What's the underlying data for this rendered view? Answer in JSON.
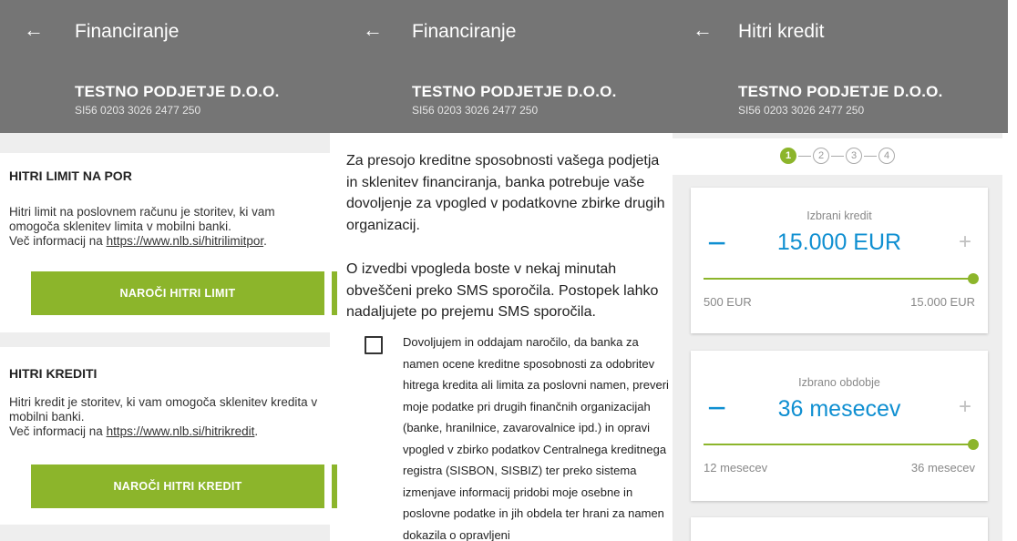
{
  "panel1": {
    "back_icon": "←",
    "title": "Financiranje",
    "company": "TESTNO PODJETJE D.O.O.",
    "iban": "SI56 0203 3026 2477 250",
    "limit": {
      "heading": "HITRI LIMIT NA POR",
      "text": "Hitri limit na poslovnem računu je storitev, ki vam omogoča sklenitev limita v mobilni banki.",
      "more_prefix": "Več informacij na ",
      "link": "https://www.nlb.si/hitrilimitpor",
      "suffix": ".",
      "button": "NAROČI HITRI LIMIT"
    },
    "credit": {
      "heading": "HITRI KREDITI",
      "text": "Hitri kredit je storitev, ki vam omogoča sklenitev kredita v mobilni banki.",
      "more_prefix": "Več informacij na ",
      "link": "https://www.nlb.si/hitrikredit",
      "suffix": ".",
      "button": "NAROČI HITRI KREDIT"
    }
  },
  "panel2": {
    "back_icon": "←",
    "title": "Financiranje",
    "company": "TESTNO PODJETJE D.O.O.",
    "iban": "SI56 0203 3026 2477 250",
    "para1": "Za presojo kreditne sposobnosti vašega podjetja in sklenitev financiranja, banka potrebuje vaše dovoljenje za vpogled v podatkovne zbirke drugih organizacij.",
    "para2": "O izvedbi vpogleda boste v nekaj minutah obveščeni preko SMS sporočila. Postopek lahko nadaljujete po prejemu SMS sporočila.",
    "consent": "Dovoljujem in oddajam naročilo, da banka za namen ocene kreditne sposobnosti za odobritev hitrega kredita ali limita za poslovni namen, preveri moje podatke pri drugih finančnih organizacijah (banke, hranilnice, zavarovalnice ipd.) in opravi vpogled v zbirko podatkov Centralnega kreditnega registra (SISBON, SISBIZ) ter preko sistema izmenjave informacij pridobi moje osebne in poslovne podatke in jih obdela ter hrani za namen dokazila o opravljeni"
  },
  "panel3": {
    "back_icon": "←",
    "title": "Hitri kredit",
    "company": "TESTNO PODJETJE D.O.O.",
    "iban": "SI56 0203 3026 2477 250",
    "steps": [
      "1",
      "2",
      "3",
      "4"
    ],
    "active_step": 1,
    "amount": {
      "label": "Izbrani kredit",
      "value": "15.000 EUR",
      "min": "500 EUR",
      "max": "15.000 EUR",
      "minus": "−",
      "plus": "+",
      "position_fraction": 1.0
    },
    "period": {
      "label": "Izbrano obdobje",
      "value": "36 mesecev",
      "min": "12 mesecev",
      "max": "36 mesecev",
      "minus": "−",
      "plus": "+",
      "position_fraction": 1.0
    }
  },
  "colors": {
    "header": "#757575",
    "accent_green": "#8cb52b",
    "value_blue": "#0f8fd1",
    "background": "#eeeeee"
  }
}
